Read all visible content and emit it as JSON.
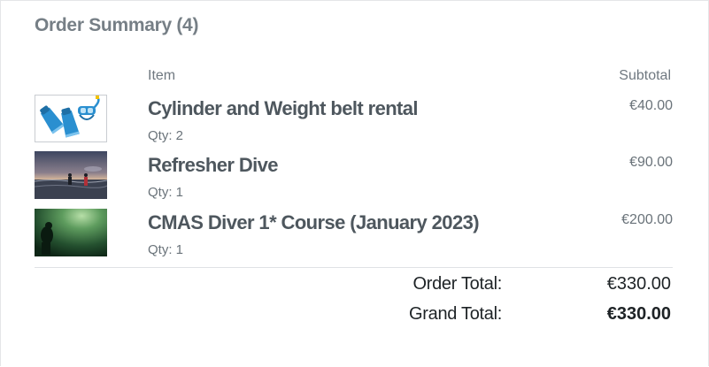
{
  "order_summary": {
    "title": "Order Summary (4)",
    "columns": {
      "item": "Item",
      "subtotal": "Subtotal"
    },
    "items": [
      {
        "name": "Cylinder and Weight belt rental",
        "qty": "Qty: 2",
        "subtotal": "€40.00",
        "image": "fins-and-mask-icon"
      },
      {
        "name": "Refresher Dive",
        "qty": "Qty: 1",
        "subtotal": "€90.00",
        "image": "divers-at-sunset-photo"
      },
      {
        "name": "CMAS Diver 1* Course (January 2023)",
        "qty": "Qty: 1",
        "subtotal": "€200.00",
        "image": "underwater-diver-photo"
      }
    ],
    "totals": {
      "order_total_label": "Order Total:",
      "order_total_value": "€330.00",
      "grand_total_label": "Grand Total:",
      "grand_total_value": "€330.00"
    }
  },
  "colors": {
    "heading": "#767f86",
    "item_text": "#4e575e",
    "total_text": "#1e2326",
    "fin_blue": "#2a8fd0"
  }
}
